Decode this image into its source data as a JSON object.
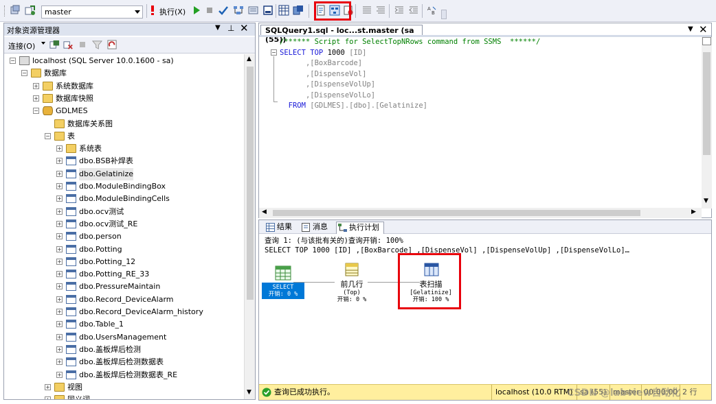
{
  "toolbar": {
    "database": "master",
    "execute_label": "执行(X)",
    "icons": [
      "register-icon",
      "connect-icon",
      "execute-icon",
      "run-icon",
      "stop-icon",
      "parse-icon",
      "display-plan-icon",
      "query-options-icon",
      "results-text-icon",
      "results-grid-icon",
      "results-file-icon",
      "comment-icon",
      "uncomment-icon",
      "indent-icon",
      "outdent-icon",
      "specify-values-icon"
    ]
  },
  "object_explorer": {
    "title": "对象资源管理器",
    "connect_label": "连接(O)",
    "tree": [
      {
        "label": "localhost (SQL Server 10.0.1600 - sa)",
        "level": 0,
        "icon": "server",
        "exp": "-"
      },
      {
        "label": "数据库",
        "level": 1,
        "icon": "folder",
        "exp": "-"
      },
      {
        "label": "系统数据库",
        "level": 2,
        "icon": "folder",
        "exp": "+"
      },
      {
        "label": "数据库快照",
        "level": 2,
        "icon": "folder",
        "exp": "+"
      },
      {
        "label": "GDLMES",
        "level": 2,
        "icon": "db",
        "exp": "-"
      },
      {
        "label": "数据库关系图",
        "level": 3,
        "icon": "folder",
        "exp": ""
      },
      {
        "label": "表",
        "level": 3,
        "icon": "folder",
        "exp": "-"
      },
      {
        "label": "系统表",
        "level": 4,
        "icon": "folder",
        "exp": "+"
      },
      {
        "label": "dbo.BSB补焊表",
        "level": 4,
        "icon": "table",
        "exp": "+"
      },
      {
        "label": "dbo.Gelatinize",
        "level": 4,
        "icon": "table",
        "exp": "+",
        "selected": true
      },
      {
        "label": "dbo.ModuleBindingBox",
        "level": 4,
        "icon": "table",
        "exp": "+"
      },
      {
        "label": "dbo.ModuleBindingCells",
        "level": 4,
        "icon": "table",
        "exp": "+"
      },
      {
        "label": "dbo.ocv测试",
        "level": 4,
        "icon": "table",
        "exp": "+"
      },
      {
        "label": "dbo.ocv测试_RE",
        "level": 4,
        "icon": "table",
        "exp": "+"
      },
      {
        "label": "dbo.person",
        "level": 4,
        "icon": "table",
        "exp": "+"
      },
      {
        "label": "dbo.Potting",
        "level": 4,
        "icon": "table",
        "exp": "+"
      },
      {
        "label": "dbo.Potting_12",
        "level": 4,
        "icon": "table",
        "exp": "+"
      },
      {
        "label": "dbo.Potting_RE_33",
        "level": 4,
        "icon": "table",
        "exp": "+"
      },
      {
        "label": "dbo.PressureMaintain",
        "level": 4,
        "icon": "table",
        "exp": "+"
      },
      {
        "label": "dbo.Record_DeviceAlarm",
        "level": 4,
        "icon": "table",
        "exp": "+"
      },
      {
        "label": "dbo.Record_DeviceAlarm_history",
        "level": 4,
        "icon": "table",
        "exp": "+"
      },
      {
        "label": "dbo.Table_1",
        "level": 4,
        "icon": "table",
        "exp": "+"
      },
      {
        "label": "dbo.UsersManagement",
        "level": 4,
        "icon": "table",
        "exp": "+"
      },
      {
        "label": "dbo.盖板焊后检测",
        "level": 4,
        "icon": "table",
        "exp": "+"
      },
      {
        "label": "dbo.盖板焊后检测数据表",
        "level": 4,
        "icon": "table",
        "exp": "+"
      },
      {
        "label": "dbo.盖板焊后检测数据表_RE",
        "level": 4,
        "icon": "table",
        "exp": "+"
      },
      {
        "label": "视图",
        "level": 3,
        "icon": "folder",
        "exp": "+"
      },
      {
        "label": "同义词",
        "level": 3,
        "icon": "folder",
        "exp": "+"
      }
    ]
  },
  "editor": {
    "tab_title": "SQLQuery1.sql - loc...st.master (sa (55))",
    "lines": [
      {
        "text": "/****** Script for SelectTopNRows command from SSMS  ******/",
        "cls": "cm",
        "indent": 0
      },
      {
        "text": "SELECT TOP 1000 [ID]",
        "cls": "mixed1",
        "indent": 0
      },
      {
        "text": ",[BoxBarcode]",
        "cls": "mixed2",
        "indent": 1
      },
      {
        "text": ",[DispenseVol]",
        "cls": "mixed2",
        "indent": 1
      },
      {
        "text": ",[DispenseVolUp]",
        "cls": "mixed2",
        "indent": 1
      },
      {
        "text": ",[DispenseVolLo]",
        "cls": "mixed2",
        "indent": 1
      },
      {
        "text": "FROM [GDLMES].[dbo].[Gelatinize]",
        "cls": "mixed3",
        "indent": 2
      }
    ]
  },
  "results": {
    "tabs": [
      "结果",
      "消息",
      "执行计划"
    ],
    "plan_line1": "查询 1: (与该批有关的)查询开销: 100%",
    "plan_line2": "SELECT TOP 1000 [ID] ,[BoxBarcode] ,[DispenseVol] ,[DispenseVolUp] ,[DispenseVolLo]…",
    "nodes": {
      "select": {
        "name": "SELECT",
        "cost": "开销: 0 %"
      },
      "top": {
        "name": "前几行",
        "sub": "(Top)",
        "cost": "开销: 0 %"
      },
      "scan": {
        "name": "表扫描",
        "sub": "[Gelatinize]",
        "cost": "开销: 100 %"
      }
    },
    "status": "查询已成功执行。",
    "server": "localhost (10.0 RTM)",
    "user": "sa (55)",
    "database": "master",
    "time": "00:00:00",
    "rows": "2 行",
    "watermark": "CSDN @labview自动化"
  },
  "colors": {
    "highlight_red": "#e8000b",
    "keyword_blue": "#1818d8",
    "comment_green": "#008000",
    "status_yellow": "#ffef9e",
    "select_node_blue": "#0078d7"
  }
}
